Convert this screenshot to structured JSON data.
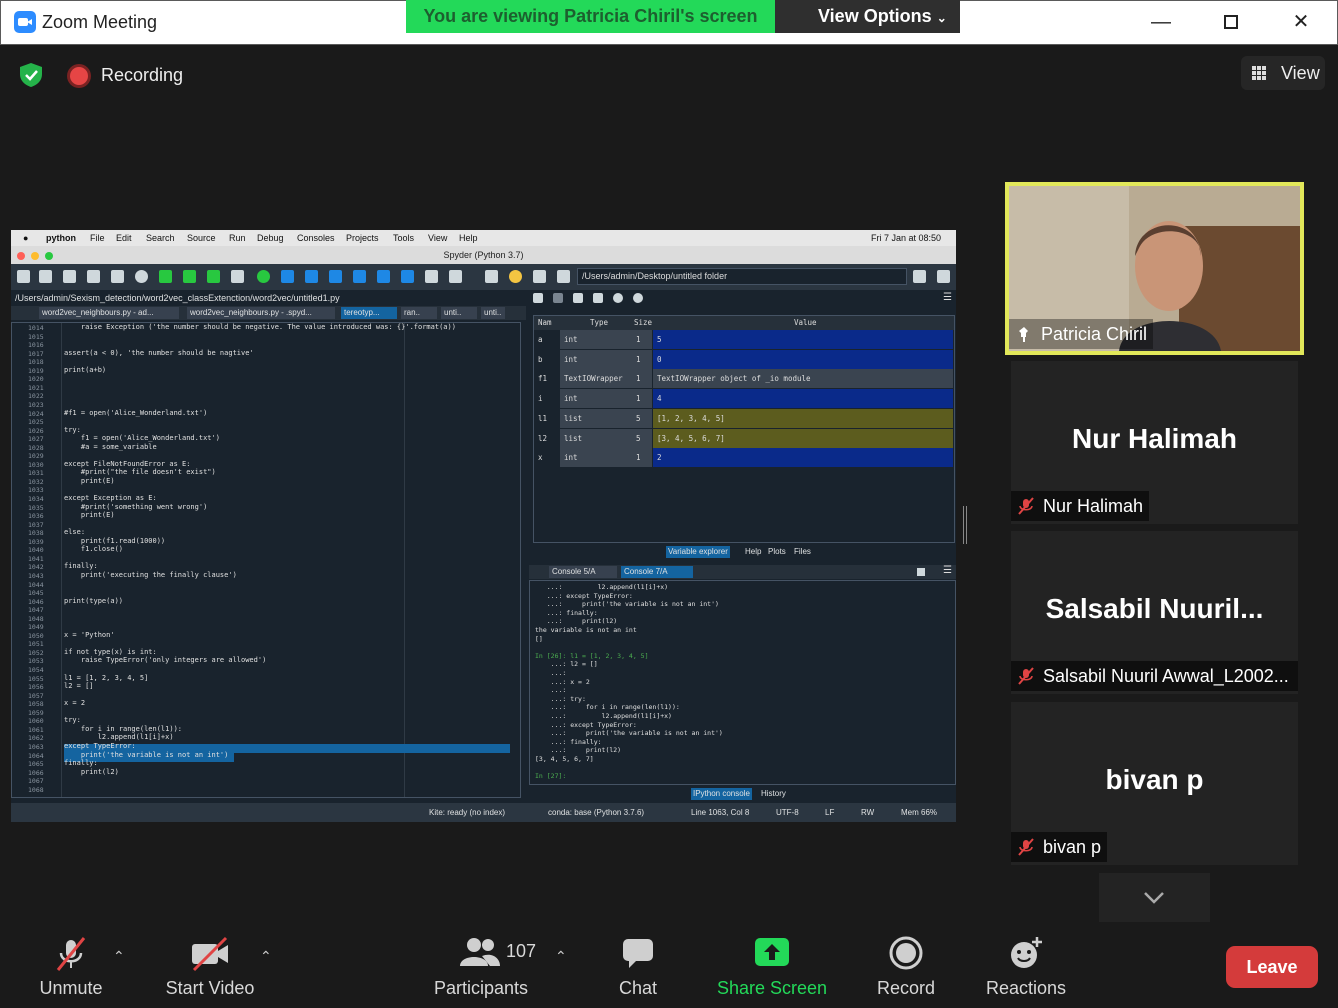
{
  "window": {
    "title": "Zoom Meeting"
  },
  "banner": {
    "sharing_text": "You are viewing Patricia Chiril's screen",
    "view_options": "View Options"
  },
  "top": {
    "recording": "Recording",
    "view": "View"
  },
  "spyder": {
    "menubar": [
      "python",
      "File",
      "Edit",
      "Search",
      "Source",
      "Run",
      "Debug",
      "Consoles",
      "Projects",
      "Tools",
      "View",
      "Help"
    ],
    "clock": "Fri 7 Jan at  08:50",
    "title": "Spyder (Python 3.7)",
    "toolbar_path": "/Users/admin/Desktop/untitled folder",
    "editor_path": "/Users/admin/Sexism_detection/word2vec_classExtenction/word2vec/untitled1.py",
    "tabs": [
      "word2vec_neighbours.py - ad...",
      "word2vec_neighbours.py - .spyd...",
      "tereotyp...",
      "ran..",
      "unti..",
      "unti.."
    ],
    "line_numbers": [
      "1014",
      "1015",
      "1016",
      "1017",
      "1018",
      "1019",
      "1020",
      "1021",
      "1022",
      "1023",
      "1024",
      "1025",
      "1026",
      "1027",
      "1028",
      "1029",
      "1030",
      "1031",
      "1032",
      "1033",
      "1034",
      "1035",
      "1036",
      "1037",
      "1038",
      "1039",
      "1040",
      "1041",
      "1042",
      "1043",
      "1044",
      "1045",
      "1046",
      "1047",
      "1048",
      "1049",
      "1050",
      "1051",
      "1052",
      "1053",
      "1054",
      "1055",
      "1056",
      "1057",
      "1058",
      "1059",
      "1060",
      "1061",
      "1062",
      "1063",
      "1064",
      "1065",
      "1066",
      "1067",
      "1068"
    ],
    "code_lines": [
      "    raise Exception ('the number should be negative. The value introduced was: {}'.format(a))",
      "",
      "",
      "assert(a < 0), 'the number should be nagtive'",
      "",
      "print(a+b)",
      "",
      "",
      "",
      "",
      "#f1 = open('Alice_Wonderland.txt')",
      "",
      "try:",
      "    f1 = open('Alice_Wonderland.txt')",
      "    #a = some_variable",
      "",
      "except FileNotFoundError as E:",
      "    #print(\"the file doesn't exist\")",
      "    print(E)",
      "",
      "except Exception as E:",
      "    #print('something went wrong')",
      "    print(E)",
      "",
      "else:",
      "    print(f1.read(1000))",
      "    f1.close()",
      "",
      "finally:",
      "    print('executing the finally clause')",
      "",
      "",
      "print(type(a))",
      "",
      "",
      "",
      "x = 'Python'",
      "",
      "if not type(x) is int:",
      "    raise TypeError('only integers are allowed')",
      "",
      "l1 = [1, 2, 3, 4, 5]",
      "l2 = []",
      "",
      "x = 2",
      "",
      "try:",
      "    for i in range(len(l1)):",
      "        l2.append(l1[i]+x)",
      "except TypeError:",
      "    print('the variable is not an int')",
      "finally:",
      "    print(l2)",
      "",
      ""
    ],
    "var_headers": [
      "Nam",
      "Type",
      "Size",
      "Value"
    ],
    "variables": [
      {
        "name": "a",
        "type": "int",
        "size": "1",
        "value": "5",
        "color": "#0a2a8a"
      },
      {
        "name": "b",
        "type": "int",
        "size": "1",
        "value": "0",
        "color": "#0a2a8a"
      },
      {
        "name": "f1",
        "type": "TextIOWrapper",
        "size": "1",
        "value": "TextIOWrapper object of _io module",
        "color": "#3a4450"
      },
      {
        "name": "i",
        "type": "int",
        "size": "1",
        "value": "4",
        "color": "#0a2a8a"
      },
      {
        "name": "l1",
        "type": "list",
        "size": "5",
        "value": "[1, 2, 3, 4, 5]",
        "color": "#5c5c1e"
      },
      {
        "name": "l2",
        "type": "list",
        "size": "5",
        "value": "[3, 4, 5, 6, 7]",
        "color": "#5c5c1e"
      },
      {
        "name": "x",
        "type": "int",
        "size": "1",
        "value": "2",
        "color": "#0a2a8a"
      }
    ],
    "pane_tabs": [
      "Variable explorer",
      "Help",
      "Plots",
      "Files"
    ],
    "console_tabs": [
      "Console 5/A",
      "Console 7/A"
    ],
    "console_lines": [
      "   ...:         l2.append(l1[i]+x)",
      "   ...: except TypeError:",
      "   ...:     print('the variable is not an int')",
      "   ...: finally:",
      "   ...:     print(l2)",
      "the variable is not an int",
      "[]",
      "",
      "In [26]: l1 = [1, 2, 3, 4, 5]",
      "    ...: l2 = []",
      "    ...:",
      "    ...: x = 2",
      "    ...:",
      "    ...: try:",
      "    ...:     for i in range(len(l1)):",
      "    ...:         l2.append(l1[i]+x)",
      "    ...: except TypeError:",
      "    ...:     print('the variable is not an int')",
      "    ...: finally:",
      "    ...:     print(l2)",
      "[3, 4, 5, 6, 7]",
      "",
      "In [27]:"
    ],
    "console_bottom_tabs": [
      "IPython console",
      "History"
    ],
    "status": {
      "kite": "Kite: ready (no index)",
      "conda": "conda: base (Python 3.7.6)",
      "position": "Line 1063, Col 8",
      "encoding": "UTF-8",
      "eol": "LF",
      "rw": "RW",
      "mem": "Mem 66%"
    }
  },
  "participants": {
    "speaker": "Patricia Chiril",
    "tiles": [
      {
        "display": "Nur Halimah",
        "tag": "Nur Halimah"
      },
      {
        "display": "Salsabil  Nuuril...",
        "tag": "Salsabil Nuuril Awwal_L2002..."
      },
      {
        "display": "bivan p",
        "tag": "bivan p"
      }
    ]
  },
  "toolbar": {
    "unmute": "Unmute",
    "start_video": "Start Video",
    "participants": "Participants",
    "participant_count": "107",
    "chat": "Chat",
    "share_screen": "Share Screen",
    "record": "Record",
    "reactions": "Reactions",
    "leave": "Leave"
  },
  "colors": {
    "share_green": "#23d959",
    "leave_red": "#d43b3b",
    "active_speaker": "#e2e85a"
  }
}
